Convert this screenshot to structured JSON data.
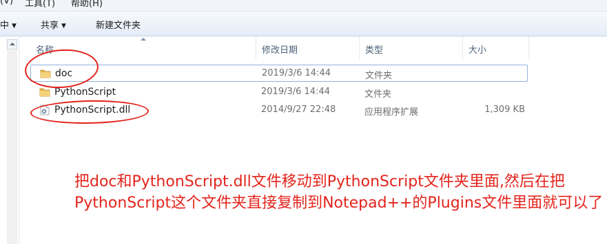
{
  "menubar": {
    "items": [
      "(V)",
      "工具(T)",
      "帮助(H)"
    ]
  },
  "toolbar": {
    "left_fragment": "中",
    "share": "共享",
    "new_folder": "新建文件夹"
  },
  "columns": {
    "name": "名称",
    "modified": "修改日期",
    "type": "类型",
    "size": "大小"
  },
  "files": [
    {
      "name": "doc",
      "modified": "2019/3/6 14:44",
      "type": "文件夹",
      "size": "",
      "icon": "folder-icon"
    },
    {
      "name": "PythonScript",
      "modified": "2019/3/6 14:44",
      "type": "文件夹",
      "size": "",
      "icon": "folder-icon"
    },
    {
      "name": "PythonScript.dll",
      "modified": "2014/9/27 22:48",
      "type": "应用程序扩展",
      "size": "1,309 KB",
      "icon": "dll-file-icon"
    }
  ],
  "annotation": {
    "text": "把doc和PythonScript.dll文件移动到PythonScript文件夹里面,然后在把PythonScript这个文件夹直接复制到Notepad++的Plugins文件里面就可以了",
    "color": "#e3241c"
  }
}
